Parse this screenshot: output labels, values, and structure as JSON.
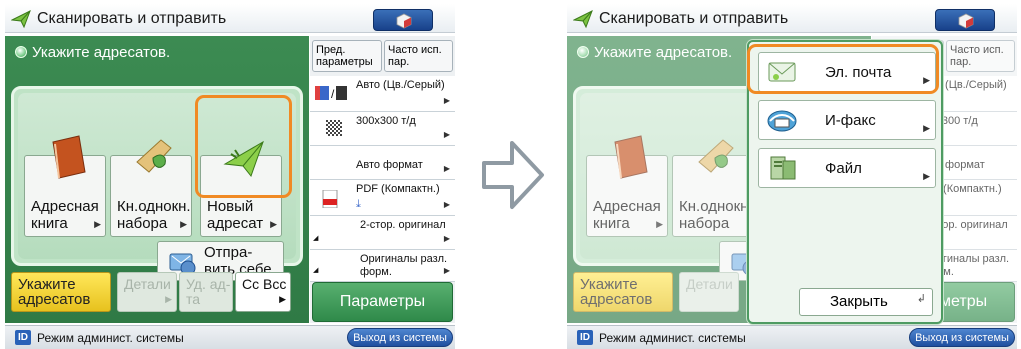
{
  "app": {
    "title": "Сканировать и отправить",
    "instruction": "Укажите адресатов."
  },
  "main": {
    "address_book": "Адресная книга",
    "one_touch": "Кн.однокн. набора",
    "new_dest": "Новый адресат",
    "send_self": "Отпра-вить себе"
  },
  "tabs": {
    "specify": "Укажите адресатов",
    "details": "Детали",
    "delete": "Уд. ад-та",
    "cc_bcc": "Cc Bcc"
  },
  "side": {
    "prev_params": "Пред. параметры",
    "freq_params": "Часто исп. пар.",
    "color_mode": "Авто (Цв./Серый)",
    "resolution": "300x300 т/д",
    "format": "Авто формат",
    "file_format": "PDF (Компактн.)",
    "duplex": "2-стор. оригинал",
    "mixed": "Оригиналы разл. форм.",
    "params_button": "Параметры"
  },
  "status": {
    "id_label": "ID",
    "mode": "Режим админист. системы",
    "logout": "Выход из системы"
  },
  "popup": {
    "email": "Эл. почта",
    "ifax": "И-факс",
    "file": "Файл",
    "close": "Закрыть"
  },
  "colors": {
    "main_green": "#3c8b52",
    "highlight_orange": "#f08a24",
    "active_tab_yellow": "#f2d23a",
    "status_blue": "#2a62b8"
  }
}
